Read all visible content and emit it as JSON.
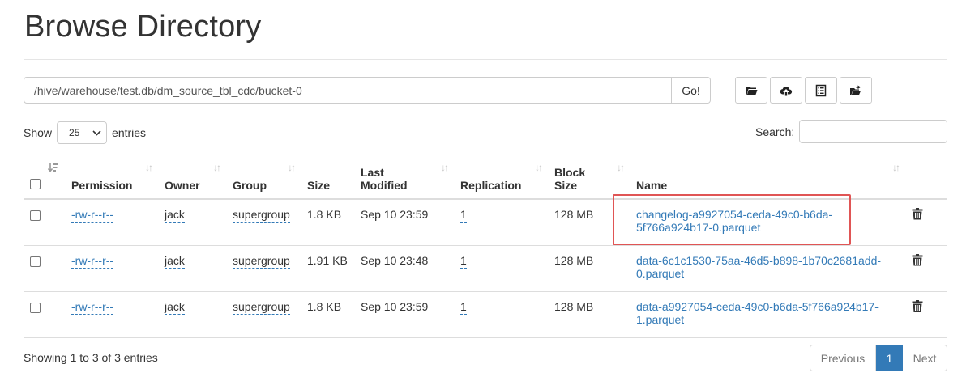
{
  "page": {
    "title": "Browse Directory"
  },
  "path_bar": {
    "path": "/hive/warehouse/test.db/dm_source_tbl_cdc/bucket-0",
    "go_label": "Go!"
  },
  "toolbar": {
    "icons": [
      "folder-open-icon",
      "cloud-upload-icon",
      "list-icon",
      "folder-move-icon"
    ]
  },
  "entries_control": {
    "show_label": "Show",
    "selected": "25",
    "entries_label": "entries"
  },
  "search": {
    "label": "Search:",
    "value": ""
  },
  "table": {
    "headers": {
      "permission": "Permission",
      "owner": "Owner",
      "group": "Group",
      "size": "Size",
      "last_modified_line1": "Last",
      "last_modified_line2": "Modified",
      "replication": "Replication",
      "block_size_line1": "Block",
      "block_size_line2": "Size",
      "name": "Name"
    },
    "rows": [
      {
        "permission": "-rw-r--r--",
        "owner": "jack",
        "group": "supergroup",
        "size": "1.8 KB",
        "last_modified": "Sep 10 23:59",
        "replication": "1",
        "block_size": "128 MB",
        "name_line1": "changelog-a9927054-ceda-49c0-b6da-",
        "name_line2": "5f766a924b17-0.parquet"
      },
      {
        "permission": "-rw-r--r--",
        "owner": "jack",
        "group": "supergroup",
        "size": "1.91 KB",
        "last_modified": "Sep 10 23:48",
        "replication": "1",
        "block_size": "128 MB",
        "name_line1": "data-6c1c1530-75aa-46d5-b898-1b70c2681add-",
        "name_line2": "0.parquet"
      },
      {
        "permission": "-rw-r--r--",
        "owner": "jack",
        "group": "supergroup",
        "size": "1.8 KB",
        "last_modified": "Sep 10 23:59",
        "replication": "1",
        "block_size": "128 MB",
        "name_line1": "data-a9927054-ceda-49c0-b6da-5f766a924b17-",
        "name_line2": "1.parquet"
      }
    ]
  },
  "footer": {
    "showing": "Showing 1 to 3 of 3 entries",
    "previous": "Previous",
    "current_page": "1",
    "next": "Next"
  },
  "colors": {
    "link": "#337ab7",
    "active_page": "#337ab7",
    "highlight": "#e05555"
  }
}
